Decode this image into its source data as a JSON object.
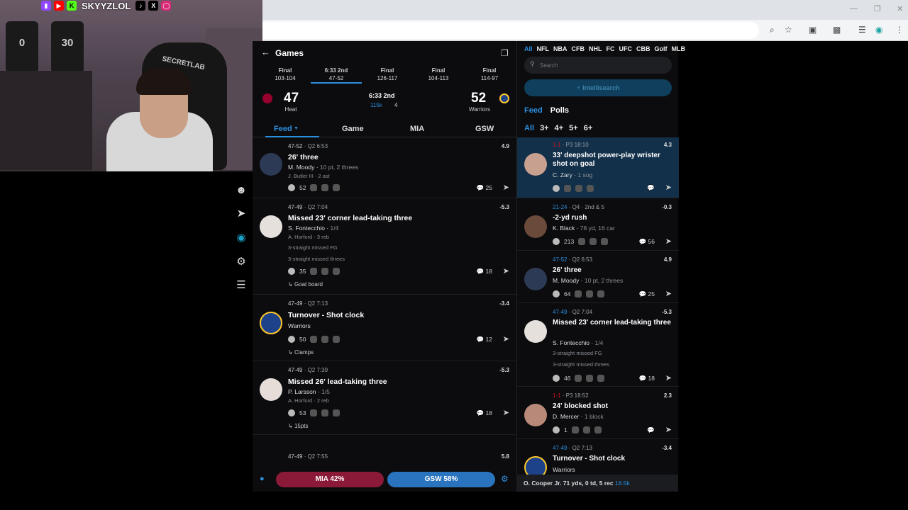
{
  "stream": {
    "streamer_name": "SKYYZLOL",
    "social_icons": [
      "twitch-icon",
      "youtube-icon",
      "kick-icon",
      "tiktok-icon",
      "x-icon",
      "instagram-icon"
    ],
    "chair_brand": "SECRETLAB",
    "shirt_numbers": [
      "0",
      "30"
    ]
  },
  "browser": {
    "window_controls": [
      "—",
      "❐",
      "✕"
    ],
    "toolbar_icons": [
      "zoom-icon",
      "bookmark-star-icon",
      "extensions-icon",
      "cast-icon",
      "media-icon",
      "extension-icon",
      "menu-icon"
    ]
  },
  "sidebar": {
    "icons": [
      "robot-icon",
      "send-icon",
      "logo-icon",
      "settings-icon",
      "hamburger-icon"
    ]
  },
  "games": {
    "title": "Games",
    "scoreboard": [
      {
        "status": "Final",
        "score": "103-104"
      },
      {
        "status": "6:33 2nd",
        "score": "47-52"
      },
      {
        "status": "Final",
        "score": "126-117"
      },
      {
        "status": "Final",
        "score": "104-113"
      },
      {
        "status": "Final",
        "score": "114-97"
      }
    ],
    "current": {
      "home_score": "47",
      "home_name": "Heat",
      "away_score": "52",
      "away_name": "Warriors",
      "clock": "6:33 2nd",
      "viewers": "115k",
      "comments": "4"
    },
    "tabs": [
      "Feed",
      "Game",
      "MIA",
      "GSW"
    ]
  },
  "feed": [
    {
      "score": "47-52",
      "time": "Q2 6:53",
      "value": "4.9",
      "title": "26' three",
      "player": "M. Moody",
      "stat": "10 pt, 2 threes",
      "extra": "J. Butler III · 2 ast",
      "reacts": "52",
      "comments": "25"
    },
    {
      "score": "47-49",
      "time": "Q2 7:04",
      "value": "-5.3",
      "title": "Missed 23' corner lead-taking three",
      "player": "S. Fontecchio",
      "stat": "1/4",
      "extra": "A. Horford · 3 reb",
      "note1": "3-straight missed FG",
      "note2": "3-straight missed threes",
      "reacts": "35",
      "comments": "18",
      "tag": "Goat board"
    },
    {
      "score": "47-49",
      "time": "Q2 7:13",
      "value": "-3.4",
      "title": "Turnover - Shot clock",
      "player": "Warriors",
      "stat": "",
      "reacts": "50",
      "comments": "12",
      "tag": "Clamps"
    },
    {
      "score": "47-49",
      "time": "Q2 7:39",
      "value": "-5.3",
      "title": "Missed 26' lead-taking three",
      "player": "P. Larsson",
      "stat": "1/5",
      "extra": "A. Horford · 2 reb",
      "reacts": "53",
      "comments": "18",
      "tag": "15pts"
    },
    {
      "score": "47-49",
      "time": "Q2 7:55",
      "value": "5.8"
    }
  ],
  "bottom": {
    "mia_label": "MIA",
    "mia_pct": "42%",
    "gsw_label": "GSW",
    "gsw_pct": "58%"
  },
  "right": {
    "leagues": [
      "All",
      "NFL",
      "NBA",
      "CFB",
      "NHL",
      "FC",
      "UFC",
      "CBB",
      "Golf",
      "MLB"
    ],
    "search_placeholder": "Search",
    "intellisearch": "Intellisearch",
    "tab_feed": "Feed",
    "tab_polls": "Polls",
    "filters": [
      "All",
      "3+",
      "4+",
      "5+",
      "6+"
    ],
    "items": [
      {
        "score": "1-1",
        "time": "P3 18:10",
        "value": "4.3",
        "title": "33' deepshot power-play wrister shot on goal",
        "player": "C. Zary",
        "stat": "1 sog"
      },
      {
        "score": "21-24",
        "time": "Q4 · 2nd & 5",
        "value": "-0.3",
        "title": "-2-yd rush",
        "player": "K. Black",
        "stat": "78 yd, 16 car",
        "reacts": "213",
        "comments": "56"
      },
      {
        "score": "47-52",
        "time": "Q2 6:53",
        "value": "4.9",
        "title": "26' three",
        "player": "M. Moody",
        "stat": "10 pt, 2 threes",
        "reacts": "64",
        "comments": "25"
      },
      {
        "score": "47-49",
        "time": "Q2 7:04",
        "value": "-5.3",
        "title": "Missed 23' corner lead-taking three",
        "player": "S. Fontecchio",
        "stat": "1/4",
        "note1": "3-straight missed FG",
        "note2": "3-straight missed threes",
        "reacts": "46",
        "comments": "18"
      },
      {
        "score": "1-1",
        "time": "P3 18:52",
        "value": "2.3",
        "title": "24' blocked shot",
        "player": "D. Mercer",
        "stat": "1 block",
        "reacts": "1"
      },
      {
        "score": "47-49",
        "time": "Q2 7:13",
        "value": "-3.4",
        "title": "Turnover - Shot clock",
        "player": "Warriors"
      }
    ],
    "ticker": "O. Cooper Jr. 71 yds, 0 td, 5 rec",
    "ticker_viewers": "18.5k"
  }
}
